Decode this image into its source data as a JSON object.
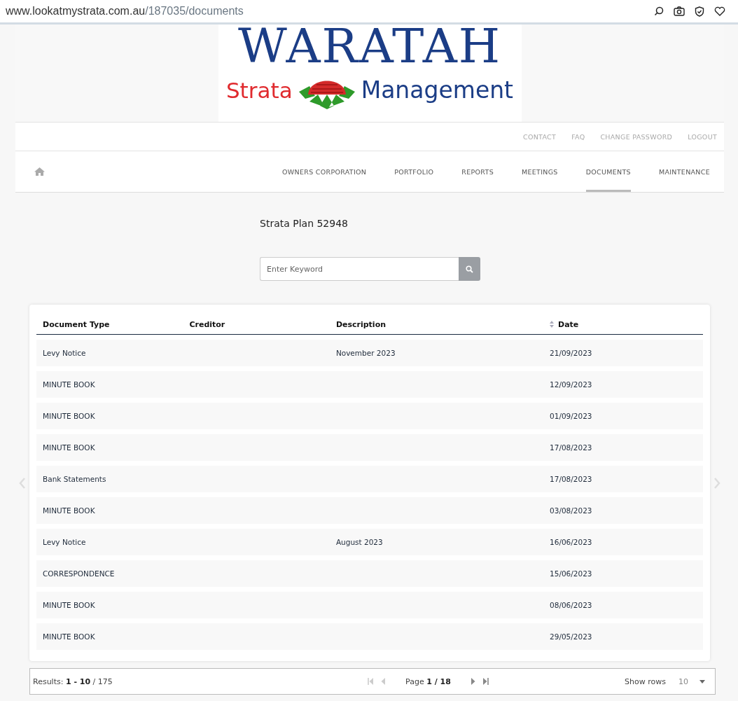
{
  "browser": {
    "url_host": "www.lookatmystrata.com.au",
    "url_path": "/187035/documents"
  },
  "logo": {
    "title": "WARATAH",
    "left_word": "Strata",
    "right_word": "Management"
  },
  "top_links": [
    "CONTACT",
    "FAQ",
    "CHANGE PASSWORD",
    "LOGOUT"
  ],
  "nav": [
    {
      "label": "OWNERS CORPORATION",
      "selected": false
    },
    {
      "label": "PORTFOLIO",
      "selected": false
    },
    {
      "label": "REPORTS",
      "selected": false
    },
    {
      "label": "MEETINGS",
      "selected": false
    },
    {
      "label": "DOCUMENTS",
      "selected": true
    },
    {
      "label": "MAINTENANCE",
      "selected": false
    }
  ],
  "plan_title": "Strata Plan 52948",
  "search": {
    "placeholder": "Enter Keyword"
  },
  "table": {
    "columns": [
      "Document Type",
      "Creditor",
      "Description",
      "Date"
    ],
    "rows": [
      [
        "Levy Notice",
        "",
        "November 2023",
        "21/09/2023"
      ],
      [
        "MINUTE BOOK",
        "",
        "",
        "12/09/2023"
      ],
      [
        "MINUTE BOOK",
        "",
        "",
        "01/09/2023"
      ],
      [
        "MINUTE BOOK",
        "",
        "",
        "17/08/2023"
      ],
      [
        "Bank Statements",
        "",
        "",
        "17/08/2023"
      ],
      [
        "MINUTE BOOK",
        "",
        "",
        "03/08/2023"
      ],
      [
        "Levy Notice",
        "",
        "August 2023",
        "16/06/2023"
      ],
      [
        "CORRESPONDENCE",
        "",
        "",
        "15/06/2023"
      ],
      [
        "MINUTE BOOK",
        "",
        "",
        "08/06/2023"
      ],
      [
        "MINUTE BOOK",
        "",
        "",
        "29/05/2023"
      ]
    ]
  },
  "pager": {
    "results": "Results: **1 - 10** / 175",
    "page": "Page **1 / 18**",
    "show_rows_label": "Show rows",
    "rows_value": "10"
  }
}
